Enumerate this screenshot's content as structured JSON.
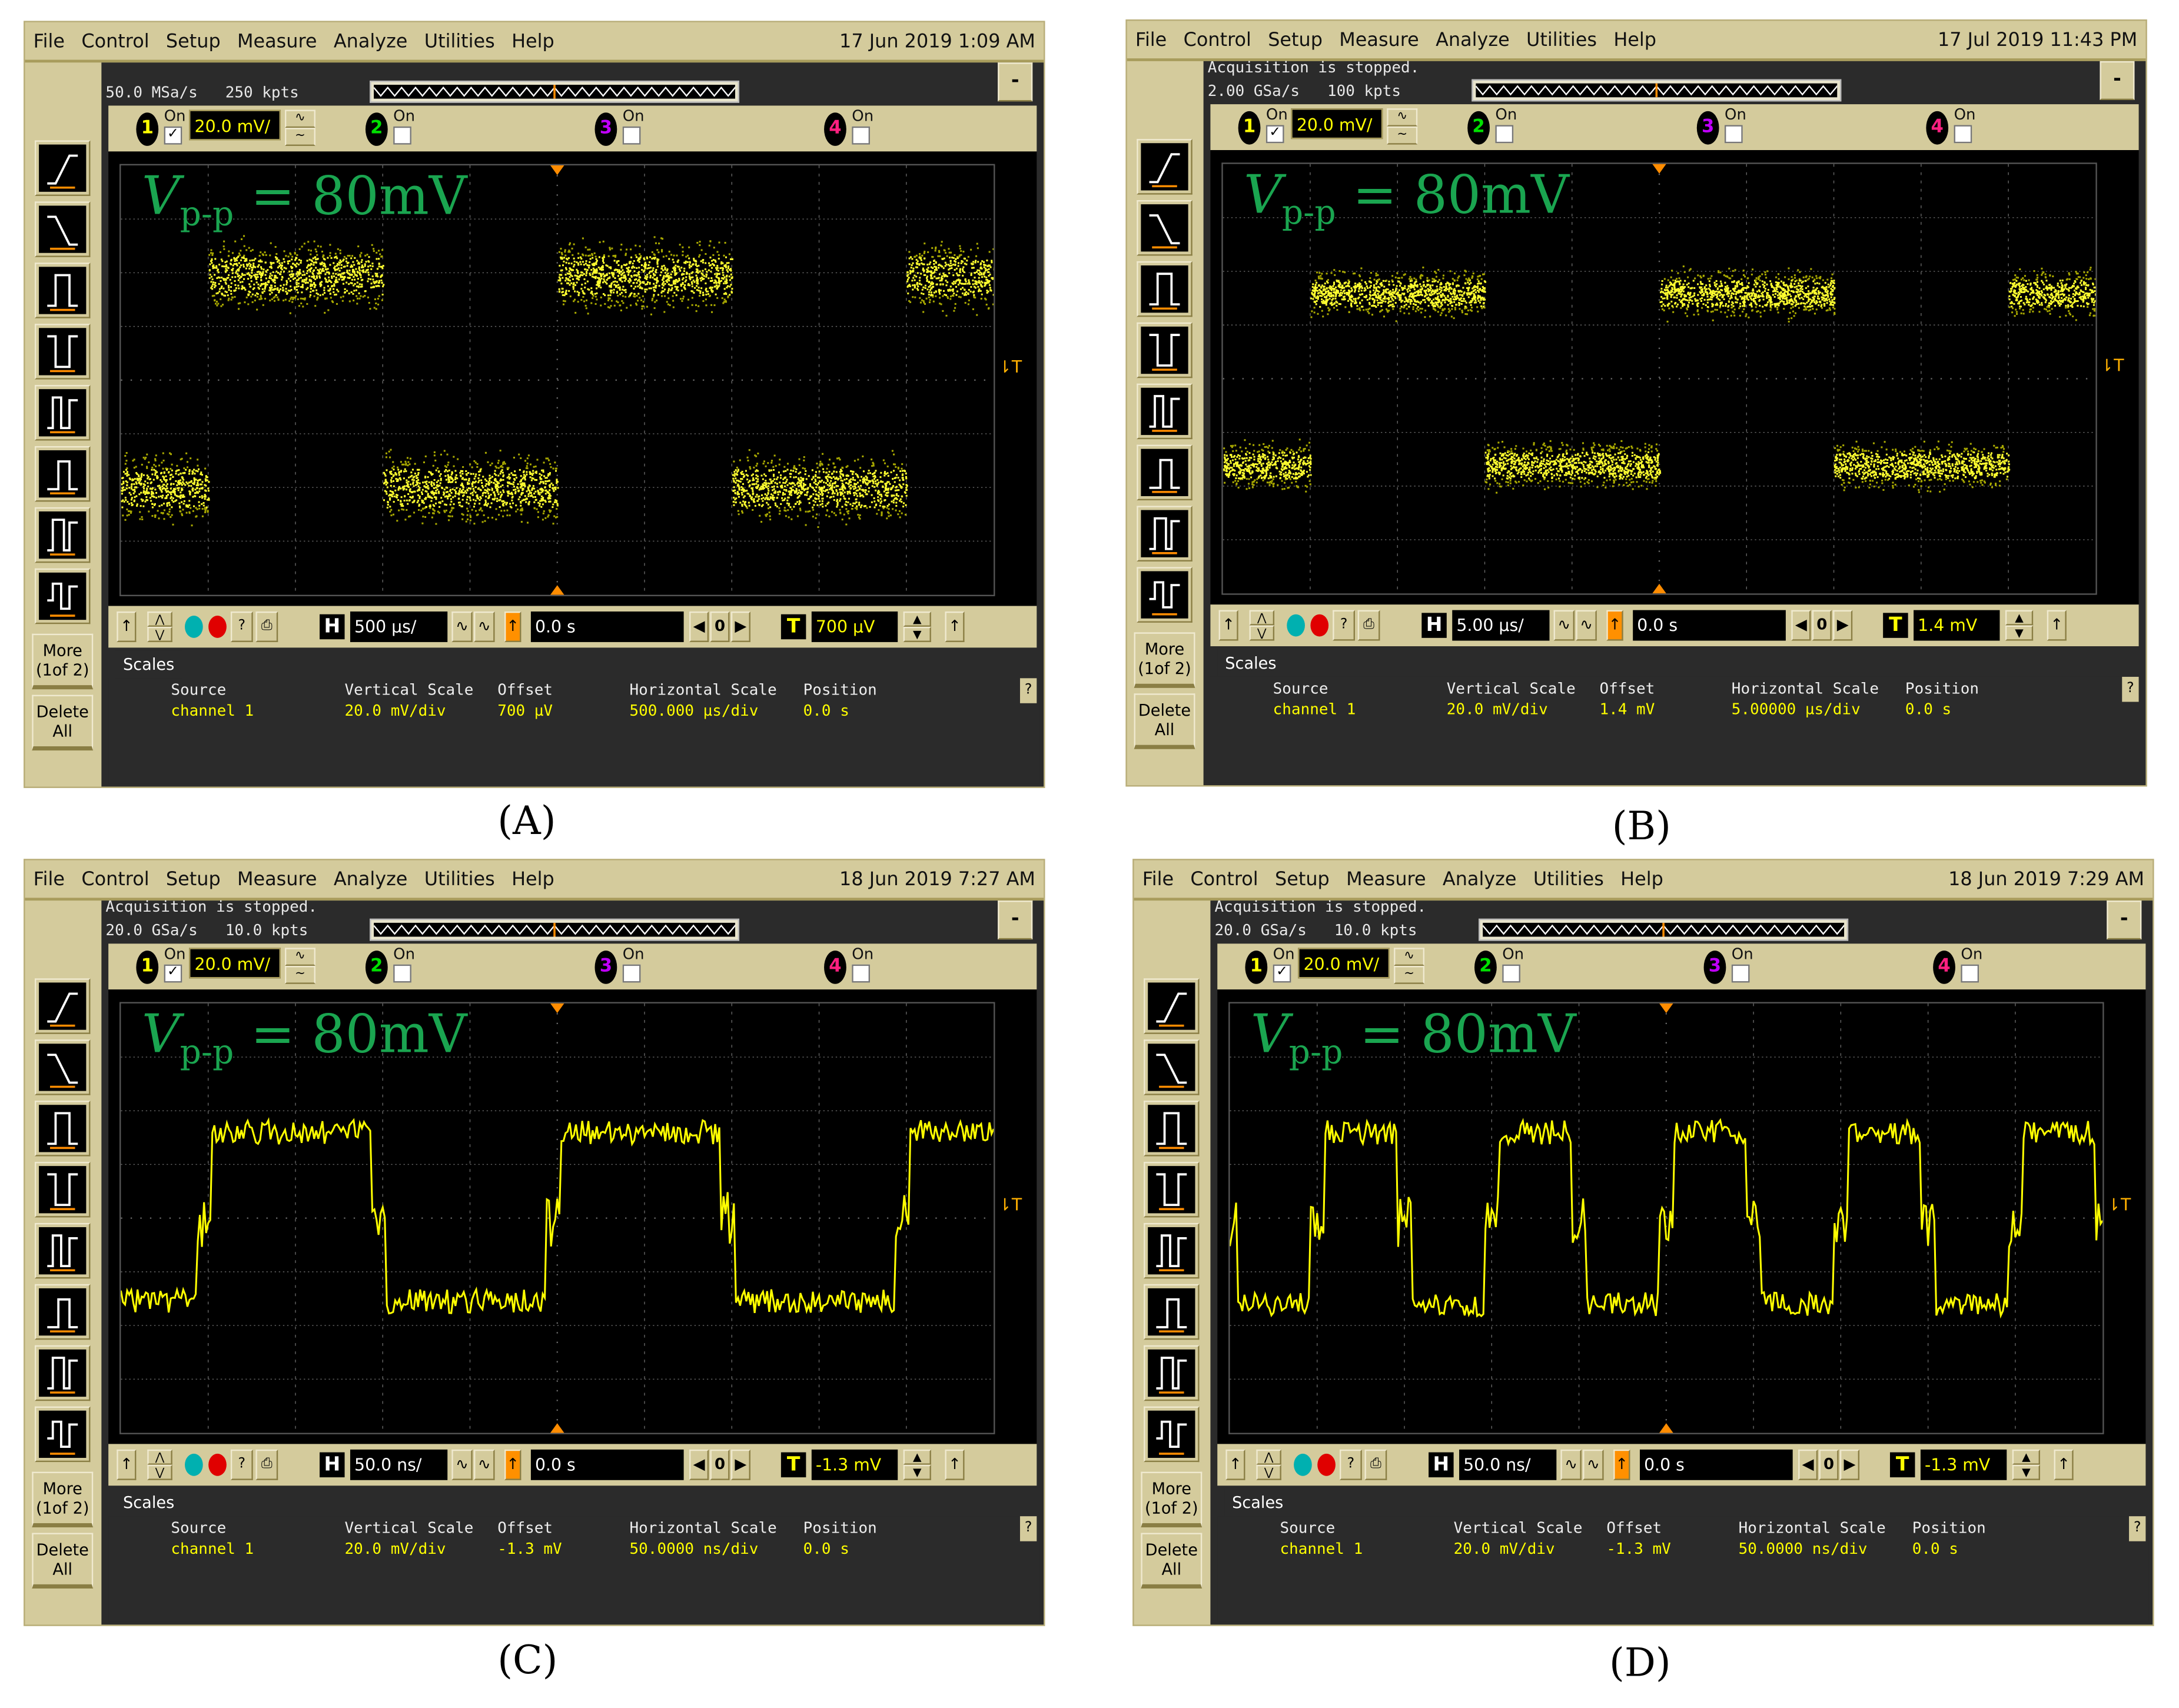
{
  "menu": [
    "File",
    "Control",
    "Setup",
    "Measure",
    "Analyze",
    "Utilities",
    "Help"
  ],
  "sidebar": {
    "more_label": "More",
    "more_sub": "(1of 2)",
    "delete_label": "Delete",
    "delete_sub": "All"
  },
  "info_headers": {
    "source": "Source",
    "vscale": "Vertical Scale",
    "offset": "Offset",
    "hscale": "Horizontal Scale",
    "position": "Position"
  },
  "tab_label": "Scales",
  "channel_on_label": "On",
  "help_label": "?",
  "annotation": {
    "v": "V",
    "sub": "p-p",
    "rest": " = 80mV"
  },
  "colors": {
    "ch1": "#ffff00",
    "ch2": "#00e000",
    "ch3": "#c000ff",
    "ch4": "#ff2080",
    "annotation": "#1aa550",
    "panel": "#d4cb9c",
    "trigger": "#ffa000"
  },
  "panels": [
    {
      "caption": "(A)",
      "datetime": "17 Jun 2019  1:09 AM",
      "status": "",
      "rate": "50.0 MSa/s   250 kpts",
      "ch1_scale": "20.0 mV/",
      "timebase": "500 µs/",
      "delay": "0.0 s",
      "trigger_level": "700 µV",
      "source": "channel 1",
      "vscale": "20.0 mV/div",
      "offset": "700 µV",
      "hscale": "500.000 µs/div",
      "position": "0.0 s",
      "trace": {
        "style": "dots",
        "period_div": 4,
        "rise_div": 1,
        "duty": 0.5,
        "high_div": 1.95,
        "low_div": -2.0,
        "spread_div": 0.8
      }
    },
    {
      "caption": "(B)",
      "datetime": "17 Jul 2019 11:43 PM",
      "status": "Acquisition is stopped.",
      "rate": "2.00 GSa/s   100 kpts",
      "ch1_scale": "20.0 mV/",
      "timebase": "5.00 µs/",
      "delay": "0.0 s",
      "trigger_level": "1.4 mV",
      "source": "channel 1",
      "vscale": "20.0 mV/div",
      "offset": "1.4 mV",
      "hscale": "5.00000 µs/div",
      "position": "0.0 s",
      "trace": {
        "style": "dots",
        "period_div": 4,
        "rise_div": 1,
        "duty": 0.5,
        "high_div": 1.6,
        "low_div": -1.6,
        "spread_div": 0.55
      }
    },
    {
      "caption": "(C)",
      "datetime": "18 Jun 2019  7:27 AM",
      "status": "Acquisition is stopped.",
      "rate": "20.0 GSa/s   10.0 kpts",
      "ch1_scale": "20.0 mV/",
      "timebase": "50.0 ns/",
      "delay": "0.0 s",
      "trigger_level": "-1.3 mV",
      "source": "channel 1",
      "vscale": "20.0 mV/div",
      "offset": "-1.3 mV",
      "hscale": "50.0000 ns/div",
      "position": "0.0 s",
      "trace": {
        "style": "line",
        "period_div": 4,
        "rise_div": 0.95,
        "duty": 0.5,
        "high_div": 1.6,
        "low_div": -1.55,
        "spread_div": 0.45
      }
    },
    {
      "caption": "(D)",
      "datetime": "18 Jun 2019  7:29 AM",
      "status": "Acquisition is stopped.",
      "rate": "20.0 GSa/s   10.0 kpts",
      "ch1_scale": "20.0 mV/",
      "timebase": "50.0 ns/",
      "delay": "0.0 s",
      "trigger_level": "-1.3 mV",
      "source": "channel 1",
      "vscale": "20.0 mV/div",
      "offset": "-1.3 mV",
      "hscale": "50.0000 ns/div",
      "position": "0.0 s",
      "trace": {
        "style": "line",
        "period_div": 2,
        "rise_div": 1.0,
        "duty": 0.5,
        "high_div": 1.6,
        "low_div": -1.6,
        "spread_div": 0.45
      }
    }
  ]
}
